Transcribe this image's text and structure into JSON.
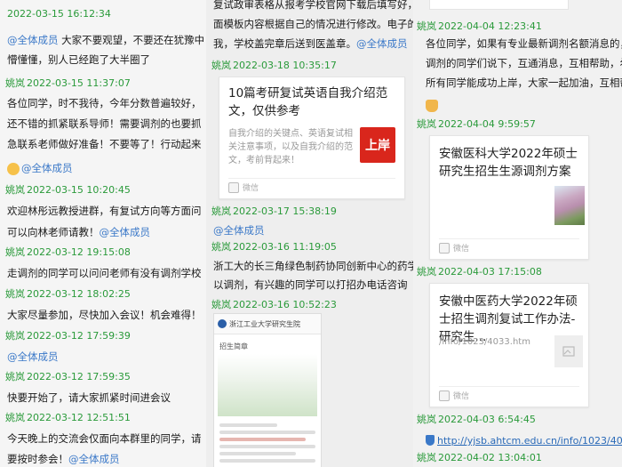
{
  "col1": {
    "rows": [
      {
        "name": "",
        "time": "2022-03-15 16:12:34"
      },
      {
        "mention": "@全体成员",
        "text": " 大家不要观望，不要还在犹豫中"
      },
      {
        "text": "懵懂懂，别人已经跑了大半圈了"
      },
      {
        "name": "姚岚",
        "time": "2022-03-15 11:37:07"
      },
      {
        "text": "各位同学，时不我待，今年分数普遍较好，"
      },
      {
        "text": "还不错的抓紧联系导师！需要调剂的也要抓"
      },
      {
        "text": "急联系老师做好准备！不要等了！行动起来"
      },
      {
        "mention": "@全体成员"
      },
      {
        "name": "姚岚",
        "time": "2022-03-15 10:20:45"
      },
      {
        "text": "欢迎林彤远教授进群，有复试方向等方面问"
      },
      {
        "text": "可以向林老师请教！",
        "mention": "@全体成员"
      },
      {
        "name": "姚岚",
        "time": "2022-03-12 19:15:08"
      },
      {
        "text": "走调剂的同学可以问问老师有没有调剂学校"
      },
      {
        "name": "姚岚",
        "time": "2022-03-12 18:02:25"
      },
      {
        "text": "大家尽量参加，尽快加入会议！机会难得！"
      },
      {
        "name": "姚岚",
        "time": "2022-03-12 17:59:39"
      },
      {
        "mention": "@全体成员"
      },
      {
        "name": "姚岚",
        "time": "2022-03-12 17:59:35"
      },
      {
        "text": "快要开始了，请大家抓紧时间进会议"
      },
      {
        "name": "姚岚",
        "time": "2022-03-12 12:51:51"
      },
      {
        "text": "今天晚上的交流会仅面向本群里的同学，请"
      },
      {
        "text": "要按时参会！",
        "mention": "@全体成员"
      }
    ]
  },
  "col2": {
    "top_line1": "复试政审表格从报考学校官网下载后填写好，",
    "top_line2": "面模板内容根据自己的情况进行修改。电子的",
    "top_line3": "我，学校盖完章后送到医盖章。",
    "top_mention": "@全体成员",
    "msg1_name": "姚岚",
    "msg1_time": "2022-03-18 10:35:17",
    "card1_title": "10篇考研复试英语自我介绍范文，仅供参考",
    "card1_desc": "自我介绍的关键点、英语复试相关注意事项，以及自我介绍的范文，考前背起来！",
    "card1_logo": "上岸",
    "card1_source": "微信",
    "msg2_name": "姚岚",
    "msg2_time": "2022-03-17 15:38:19",
    "msg2_mention": "@全体成员",
    "msg3_name": "姚岚",
    "msg3_time": "2022-03-16 11:19:05",
    "msg3_line1": "浙工大的长三角绿色制药协同创新中心的药学",
    "msg3_line2": "以调剂，有兴趣的同学可以打招办电话咨询",
    "msg4_name": "姚岚",
    "msg4_time": "2022-03-16 10:52:23",
    "shot_header": "浙江工业大学研究生院",
    "shot_title": "招生简章"
  },
  "col3": {
    "top_time": "2022-04-04 12:23:41",
    "top_name": "姚岚",
    "top_line1": "各位同学，如果有专业最新调剂名额消息的，给",
    "top_line2": "调剂的同学们说下，互通消息，互相帮助，希望群",
    "top_line3": "所有同学能成功上岸，大家一起加油，互相帮助！",
    "msg1_name": "姚岚",
    "msg1_time": "2022-04-04 9:59:57",
    "card1_title": "安徽医科大学2022年硕士研究生招生生源调剂方案",
    "card1_source": "微信",
    "msg2_name": "姚岚",
    "msg2_time": "2022-04-03 17:15:08",
    "card2_title": "安徽中医药大学2022年硕士招生调剂复试工作办法-研究生...",
    "card2_url": "/info/1023/4033.htm",
    "card2_source": "微信",
    "msg3_name": "姚岚",
    "msg3_time": "2022-04-03 6:54:45",
    "link": "http://yjsb.ahtcm.edu.cn/info/1023/4033.ht",
    "msg4_name": "姚岚",
    "msg4_time": "2022-04-02 13:04:01"
  }
}
